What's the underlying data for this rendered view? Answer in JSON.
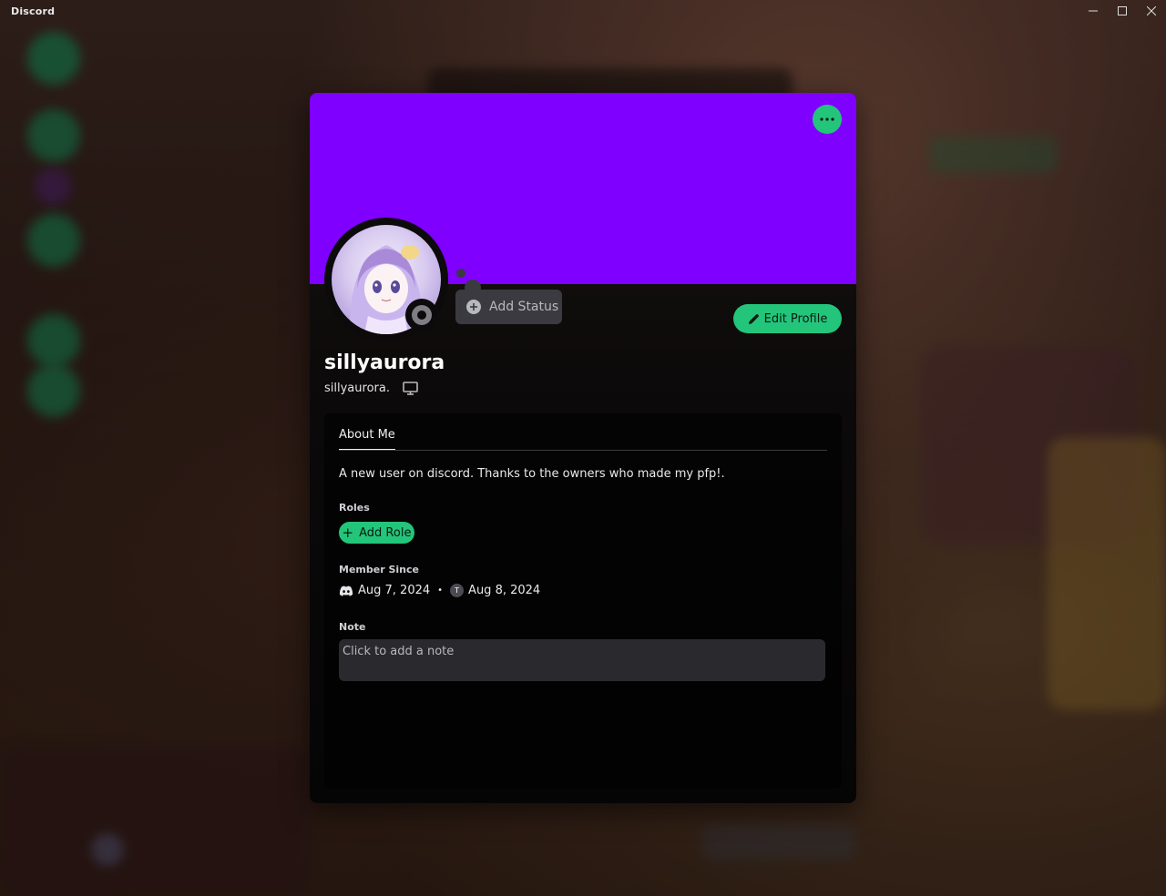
{
  "window": {
    "app_title": "Discord",
    "minimize_icon": "minimize-icon",
    "maximize_icon": "maximize-icon",
    "close_icon": "close-icon"
  },
  "profile": {
    "banner_color": "#8000ff",
    "accent_color": "#23c57a",
    "display_name": "sillyaurora",
    "username": "sillyaurora.",
    "status": "offline",
    "add_status_label": "Add Status",
    "edit_profile_label": "Edit Profile",
    "device_icon": "desktop-icon"
  },
  "tabs": {
    "about_me_label": "About Me"
  },
  "about": {
    "bio": "A new user on discord. Thanks to the owners who made my pfp!.",
    "roles_label": "Roles",
    "add_role_label": "Add Role",
    "member_since_label": "Member Since",
    "discord_member_since": "Aug 7, 2024",
    "server_initial": "T",
    "server_member_since": "Aug 8, 2024",
    "note_label": "Note",
    "note_placeholder": "Click to add a note"
  }
}
